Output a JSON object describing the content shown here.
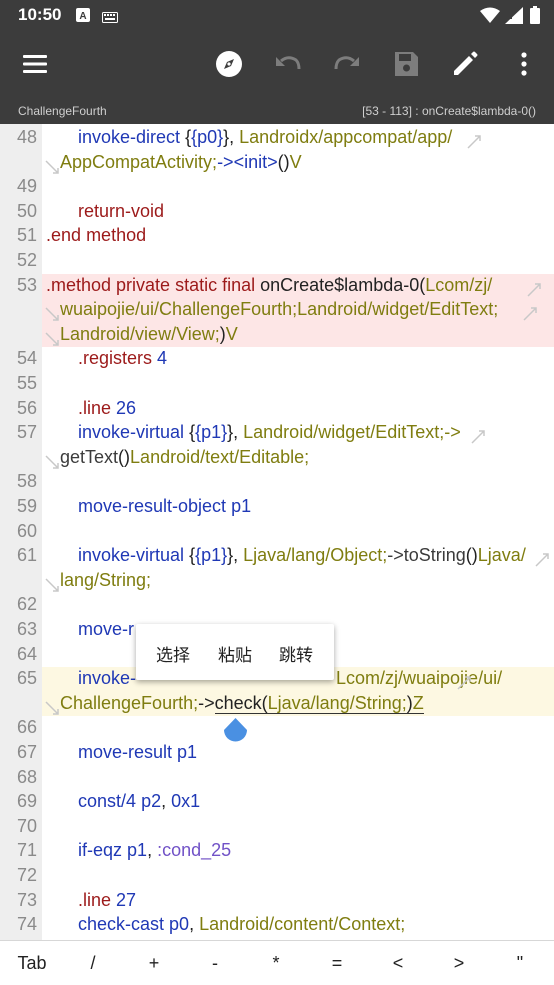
{
  "status_bar": {
    "time": "10:50"
  },
  "path_bar": {
    "file": "ChallengeFourth",
    "position": "[53 - 113] : onCreate$lambda-0()"
  },
  "popup_menu": {
    "items": [
      "选择",
      "粘贴",
      "跳转"
    ]
  },
  "keyboard_row": {
    "keys": [
      "Tab",
      "/",
      "+",
      "-",
      "*",
      "=",
      "<",
      ">",
      "\""
    ]
  },
  "line_numbers": [
    "48",
    "49",
    "50",
    "51",
    "52",
    "53",
    "54",
    "55",
    "56",
    "57",
    "58",
    "59",
    "60",
    "61",
    "62",
    "63",
    "64",
    "65",
    "66",
    "67",
    "68",
    "69",
    "70",
    "71",
    "72",
    "73",
    "74"
  ],
  "code": {
    "l48a": {
      "kw": "invoke-direct",
      "reg": "{p0}",
      "ty": "Landroidx/appcompat/app/"
    },
    "l48b": {
      "ty": "AppCompatActivity;",
      "op": "-><init>",
      "par": "()",
      "ret": "V"
    },
    "l50": {
      "kw": "return-void"
    },
    "l51": {
      "kw1": ".end",
      "kw2": "method"
    },
    "l53a": {
      "kw": ".method private static final",
      "name": "onCreate$lambda-0",
      "par": "(",
      "ty": "Lcom/zj/"
    },
    "l53b": {
      "ty": "wuaipojie/ui/ChallengeFourth;Landroid/widget/EditText;"
    },
    "l53c": {
      "ty": "Landroid/view/View;",
      "par": ")",
      "ret": "V"
    },
    "l54": {
      "kw": ".registers",
      "num": "4"
    },
    "l56": {
      "kw": ".line",
      "num": "26"
    },
    "l57a": {
      "kw": "invoke-virtual",
      "reg": "{p1}",
      "ty": "Landroid/widget/EditText;->"
    },
    "l57b": {
      "m": "getText",
      "par": "()",
      "ty": "Landroid/text/Editable;"
    },
    "l59": {
      "kw": "move-result-object",
      "reg": "p1"
    },
    "l61a": {
      "kw": "invoke-virtual",
      "reg": "{p1}",
      "ty": "Ljava/lang/Object;",
      "op": "->toString",
      "par": "()",
      "ty2": "Ljava/"
    },
    "l61b": {
      "ty": "lang/String;"
    },
    "l63": {
      "kw": "move-r"
    },
    "l65a": {
      "kw": "invoke-",
      "ty": "Lcom/zj/wuaipojie/ui/"
    },
    "l65b": {
      "ty": "ChallengeFourth;",
      "op": "->",
      "m": "check",
      "par": "(",
      "ty2": "Ljava/lang/String;",
      "par2": ")",
      "ret": "Z"
    },
    "l67": {
      "kw": "move-result",
      "reg": "p1"
    },
    "l69": {
      "kw": "const/4",
      "reg": "p2",
      "sep": ",",
      "num": "0x1"
    },
    "l71": {
      "kw": "if-eqz",
      "reg": "p1",
      "sep": ",",
      "label": ":cond_25"
    },
    "l73": {
      "kw": ".line",
      "num": "27"
    },
    "l74": {
      "kw": "check-cast",
      "reg": "p0",
      "sep": ",",
      "ty": "Landroid/content/Context;"
    }
  }
}
